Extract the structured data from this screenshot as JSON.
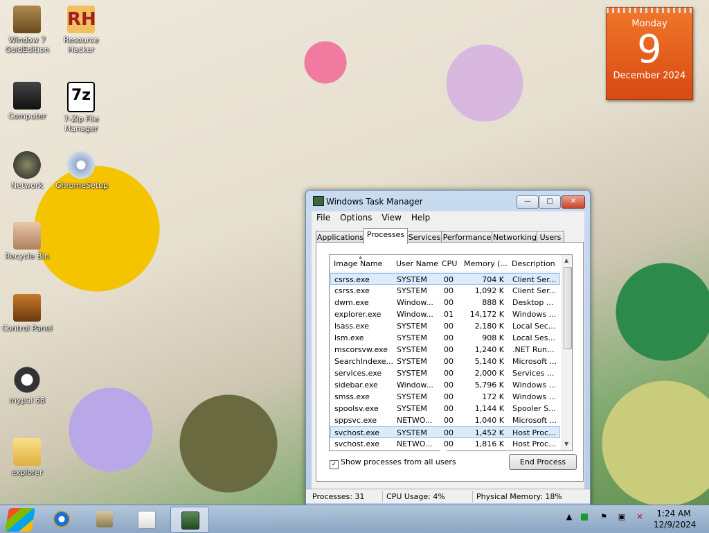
{
  "desktop": {
    "icons": [
      {
        "label": "Window 7 GoldEdition",
        "icon": "user-folder-icon"
      },
      {
        "label": "Resource Hacker",
        "icon": "rh-app-icon"
      },
      {
        "label": "Computer",
        "icon": "computer-icon"
      },
      {
        "label": "7-Zip File Manager",
        "icon": "7zip-icon"
      },
      {
        "label": "Network",
        "icon": "network-icon"
      },
      {
        "label": "GhromeSetup",
        "icon": "installer-disc-icon"
      },
      {
        "label": "Recycle Bin",
        "icon": "recycle-bin-icon"
      },
      {
        "label": "Control Panel",
        "icon": "control-panel-icon"
      },
      {
        "label": "mypal 68",
        "icon": "mypal-raccoon-icon"
      },
      {
        "label": "explorer",
        "icon": "folder-icon"
      }
    ]
  },
  "calendar": {
    "day_name": "Monday",
    "day_number": "9",
    "month_year": "December 2024"
  },
  "window": {
    "title": "Windows Task Manager",
    "controls": {
      "minimize": "—",
      "maximize": "□",
      "close": "✕"
    },
    "menu": [
      "File",
      "Options",
      "View",
      "Help"
    ],
    "tabs": [
      "Applications",
      "Processes",
      "Services",
      "Performance",
      "Networking",
      "Users"
    ],
    "active_tab": "Processes",
    "columns": [
      "Image Name",
      "User Name",
      "CPU",
      "Memory (...",
      "Description"
    ],
    "processes": [
      {
        "name": "csrss.exe",
        "user": "SYSTEM",
        "cpu": "00",
        "mem": "704 K",
        "desc": "Client Ser..."
      },
      {
        "name": "csrss.exe",
        "user": "SYSTEM",
        "cpu": "00",
        "mem": "1,092 K",
        "desc": "Client Ser..."
      },
      {
        "name": "dwm.exe",
        "user": "Window...",
        "cpu": "00",
        "mem": "888 K",
        "desc": "Desktop ..."
      },
      {
        "name": "explorer.exe",
        "user": "Window...",
        "cpu": "01",
        "mem": "14,172 K",
        "desc": "Windows ..."
      },
      {
        "name": "lsass.exe",
        "user": "SYSTEM",
        "cpu": "00",
        "mem": "2,180 K",
        "desc": "Local Sec..."
      },
      {
        "name": "lsm.exe",
        "user": "SYSTEM",
        "cpu": "00",
        "mem": "908 K",
        "desc": "Local Ses..."
      },
      {
        "name": "mscorsvw.exe",
        "user": "SYSTEM",
        "cpu": "00",
        "mem": "1,240 K",
        "desc": ".NET Run..."
      },
      {
        "name": "SearchIndexe...",
        "user": "SYSTEM",
        "cpu": "00",
        "mem": "5,140 K",
        "desc": "Microsoft ..."
      },
      {
        "name": "services.exe",
        "user": "SYSTEM",
        "cpu": "00",
        "mem": "2,000 K",
        "desc": "Services ..."
      },
      {
        "name": "sidebar.exe",
        "user": "Window...",
        "cpu": "00",
        "mem": "5,796 K",
        "desc": "Windows ..."
      },
      {
        "name": "smss.exe",
        "user": "SYSTEM",
        "cpu": "00",
        "mem": "172 K",
        "desc": "Windows ..."
      },
      {
        "name": "spoolsv.exe",
        "user": "SYSTEM",
        "cpu": "00",
        "mem": "1,144 K",
        "desc": "Spooler S..."
      },
      {
        "name": "sppsvc.exe",
        "user": "NETWO...",
        "cpu": "00",
        "mem": "1,040 K",
        "desc": "Microsoft ..."
      },
      {
        "name": "svchost.exe",
        "user": "SYSTEM",
        "cpu": "00",
        "mem": "1,452 K",
        "desc": "Host Proc..."
      },
      {
        "name": "svchost.exe",
        "user": "NETWO...",
        "cpu": "00",
        "mem": "1,816 K",
        "desc": "Host Proc..."
      }
    ],
    "selected_rows": [
      0,
      13
    ],
    "show_all_label": "Show processes from all users",
    "show_all_checked": true,
    "end_process_label": "End Process",
    "status": {
      "processes": "Processes: 31",
      "cpu": "CPU Usage: 4%",
      "memory": "Physical Memory: 18%"
    }
  },
  "taskbar": {
    "items": [
      "internet-explorer-icon",
      "media-center-icon",
      "media-player-icon",
      "task-manager-icon"
    ],
    "active_item": "task-manager-icon",
    "tray": [
      "show-hidden-icons-arrow",
      "green-square-icon",
      "flag-icon",
      "network-icon",
      "volume-muted-icon"
    ],
    "clock_time": "1:24 AM",
    "clock_date": "12/9/2024"
  }
}
